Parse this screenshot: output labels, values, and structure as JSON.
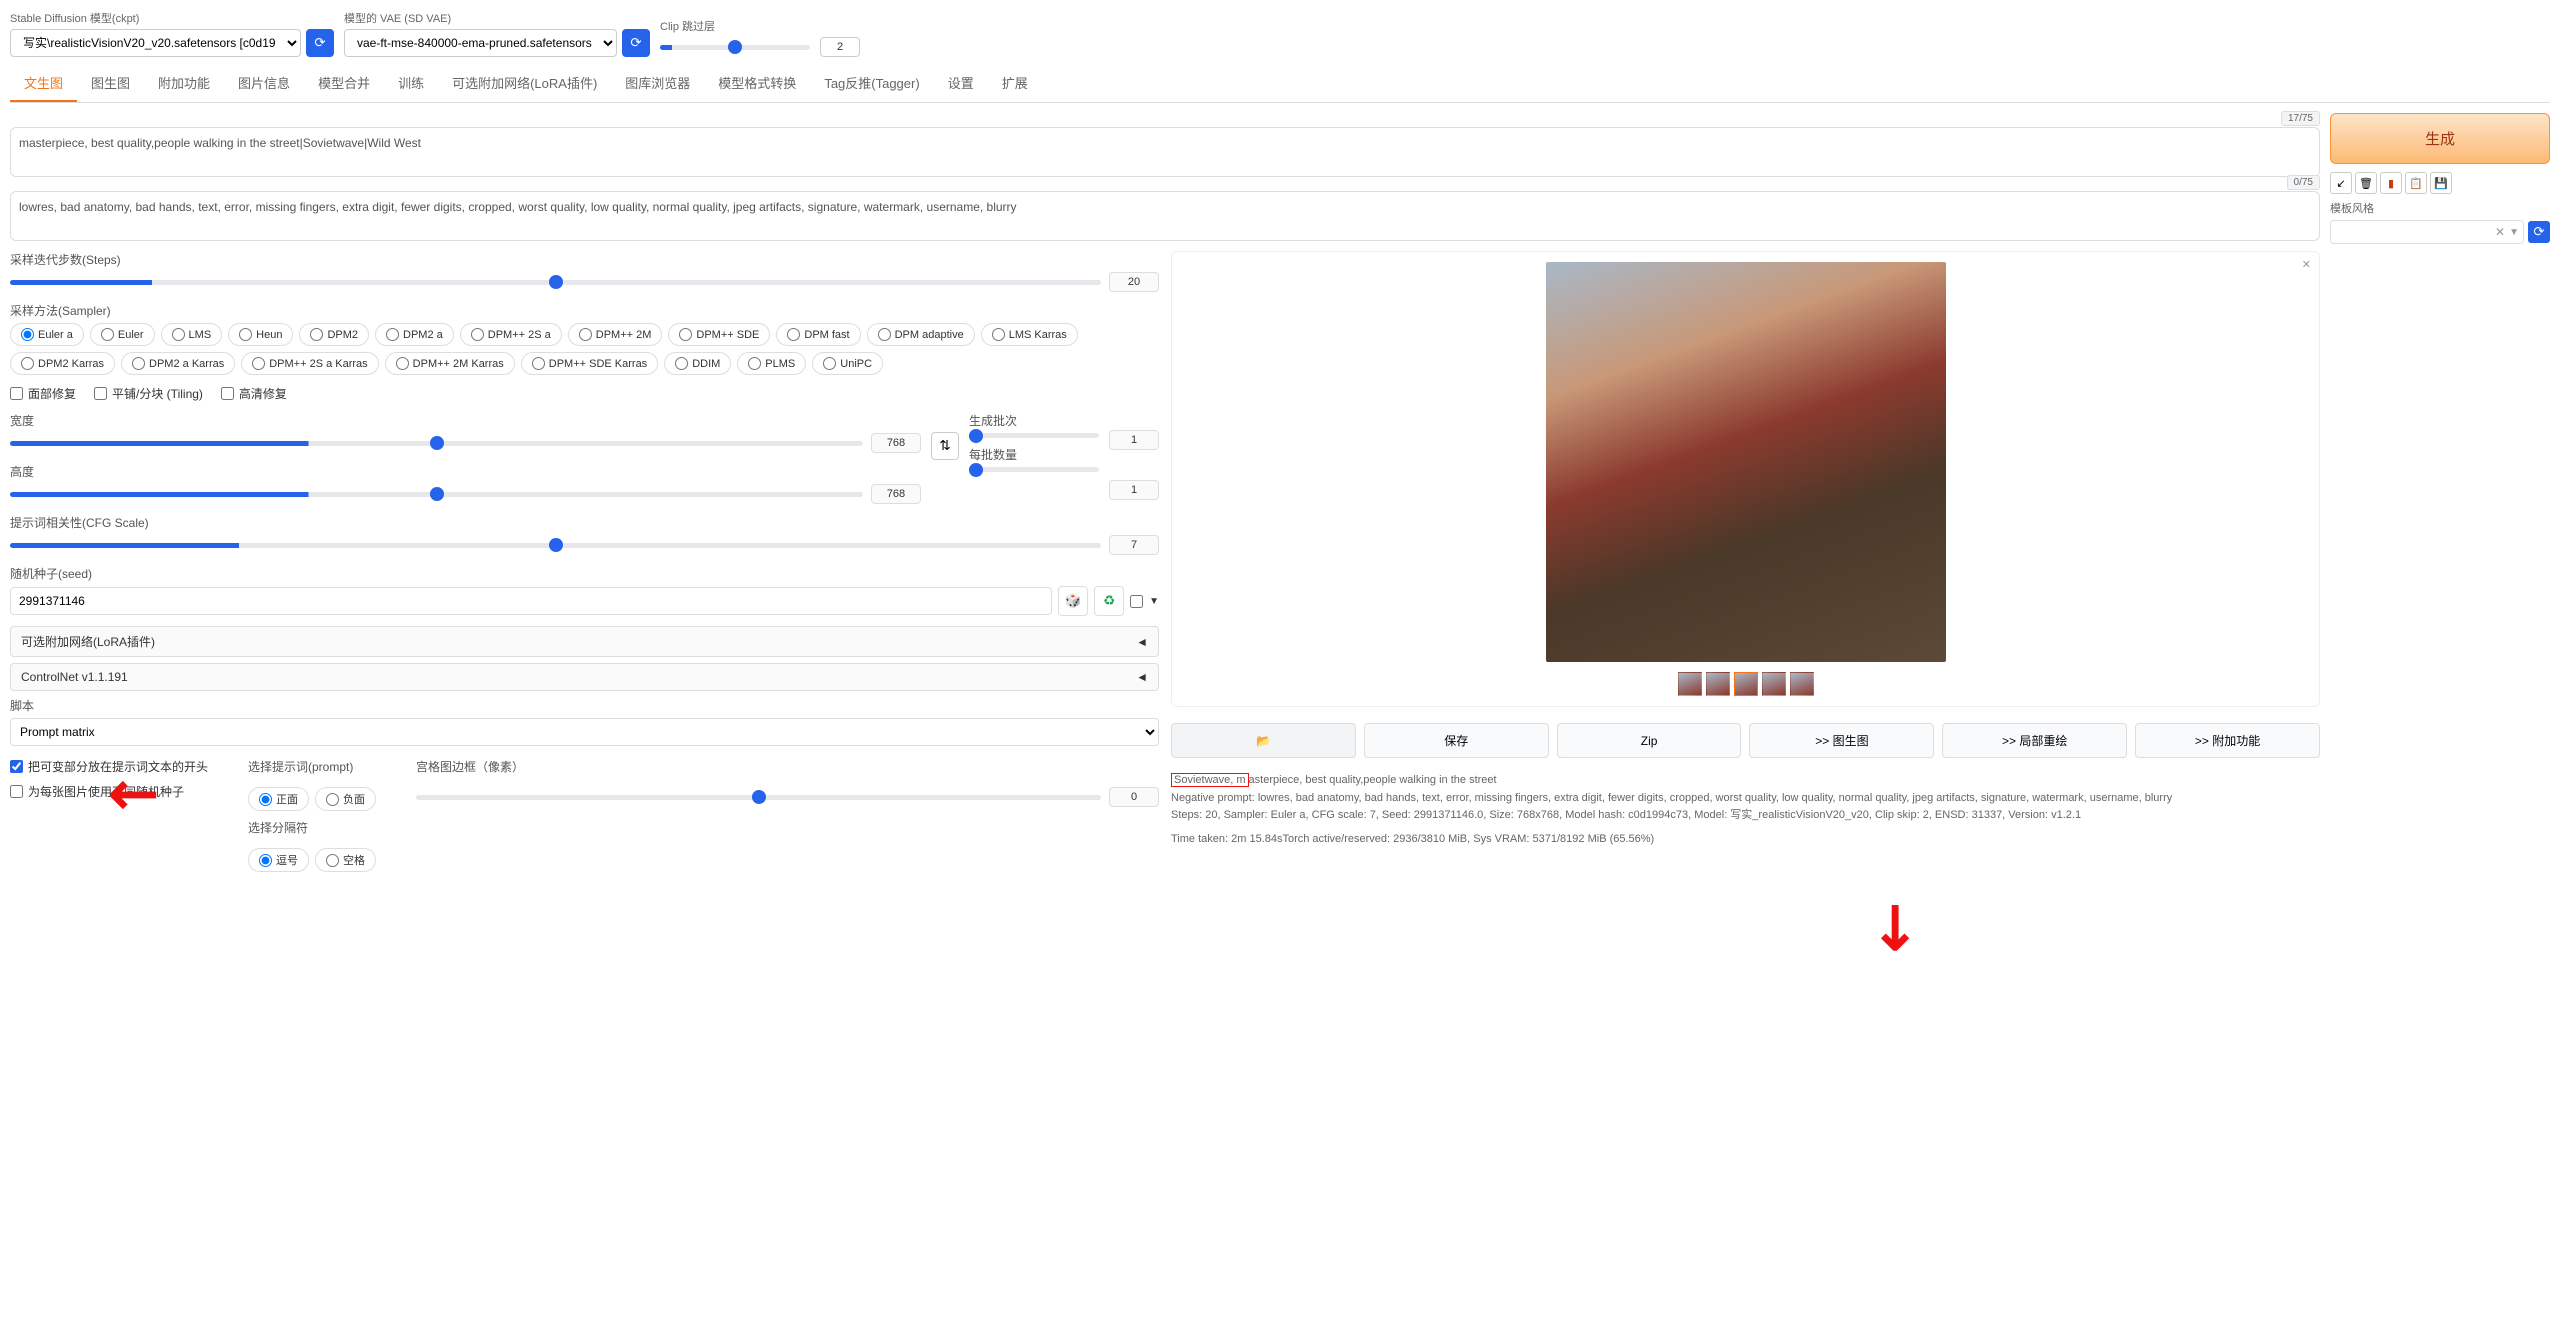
{
  "header": {
    "model_label": "Stable Diffusion 模型(ckpt)",
    "model_value": "写实\\realisticVisionV20_v20.safetensors [c0d19",
    "vae_label": "模型的 VAE (SD VAE)",
    "vae_value": "vae-ft-mse-840000-ema-pruned.safetensors",
    "clip_label": "Clip 跳过层",
    "clip_value": "2"
  },
  "tabs": [
    "文生图",
    "图生图",
    "附加功能",
    "图片信息",
    "模型合并",
    "训练",
    "可选附加网络(LoRA插件)",
    "图库浏览器",
    "模型格式转换",
    "Tag反推(Tagger)",
    "设置",
    "扩展"
  ],
  "prompts": {
    "pos": "masterpiece, best quality,people walking in the street|Sovietwave|Wild West",
    "pos_count": "17/75",
    "neg": "lowres, bad anatomy, bad hands, text, error, missing fingers, extra digit, fewer digits, cropped, worst quality, low quality, normal quality, jpeg artifacts, signature, watermark, username, blurry",
    "neg_count": "0/75"
  },
  "generate": "生成",
  "style_label": "模板风格",
  "settings": {
    "steps_label": "采样迭代步数(Steps)",
    "steps": "20",
    "sampler_label": "采样方法(Sampler)",
    "samplers": [
      "Euler a",
      "Euler",
      "LMS",
      "Heun",
      "DPM2",
      "DPM2 a",
      "DPM++ 2S a",
      "DPM++ 2M",
      "DPM++ SDE",
      "DPM fast",
      "DPM adaptive",
      "LMS Karras",
      "DPM2 Karras",
      "DPM2 a Karras",
      "DPM++ 2S a Karras",
      "DPM++ 2M Karras",
      "DPM++ SDE Karras",
      "DDIM",
      "PLMS",
      "UniPC"
    ],
    "face_restore": "面部修复",
    "tiling": "平铺/分块 (Tiling)",
    "hires": "高清修复",
    "width_label": "宽度",
    "width": "768",
    "height_label": "高度",
    "height": "768",
    "batch_count_label": "生成批次",
    "batch_count": "1",
    "batch_size_label": "每批数量",
    "batch_size": "1",
    "cfg_label": "提示词相关性(CFG Scale)",
    "cfg": "7",
    "seed_label": "随机种子(seed)",
    "seed": "2991371146",
    "lora_accordion": "可选附加网络(LoRA插件)",
    "controlnet_accordion": "ControlNet v1.1.191",
    "script_label": "脚本",
    "script_value": "Prompt matrix",
    "put_start": "把可变部分放在提示词文本的开头",
    "diff_seed": "为每张图片使用不同随机种子",
    "select_prompt_label": "选择提示词(prompt)",
    "positive": "正面",
    "negative": "负面",
    "select_delim_label": "选择分隔符",
    "comma": "逗号",
    "space": "空格",
    "margin_label": "宫格图边框（像素）",
    "margin": "0"
  },
  "swap_icon": "⇅",
  "dice_icon": "🎲",
  "recycle_icon": "♻",
  "output": {
    "actions": {
      "folder": "📂",
      "save": "保存",
      "zip": "Zip",
      "img2img": ">> 图生图",
      "inpaint": ">> 局部重绘",
      "extras": ">> 附加功能"
    },
    "info_prompt": "Sovietwave, masterpiece, best quality,people walking in the street",
    "info_neg": "Negative prompt: lowres, bad anatomy, bad hands, text, error, missing fingers, extra digit, fewer digits, cropped, worst quality, low quality, normal quality, jpeg artifacts, signature, watermark, username, blurry",
    "info_params": "Steps: 20, Sampler: Euler a, CFG scale: 7, Seed: 2991371146.0, Size: 768x768, Model hash: c0d1994c73, Model: 写实_realisticVisionV20_v20, Clip skip: 2, ENSD: 31337, Version: v1.2.1",
    "info_time": "Time taken: 2m 15.84sTorch active/reserved: 2936/3810 MiB, Sys VRAM: 5371/8192 MiB (65.56%)"
  }
}
